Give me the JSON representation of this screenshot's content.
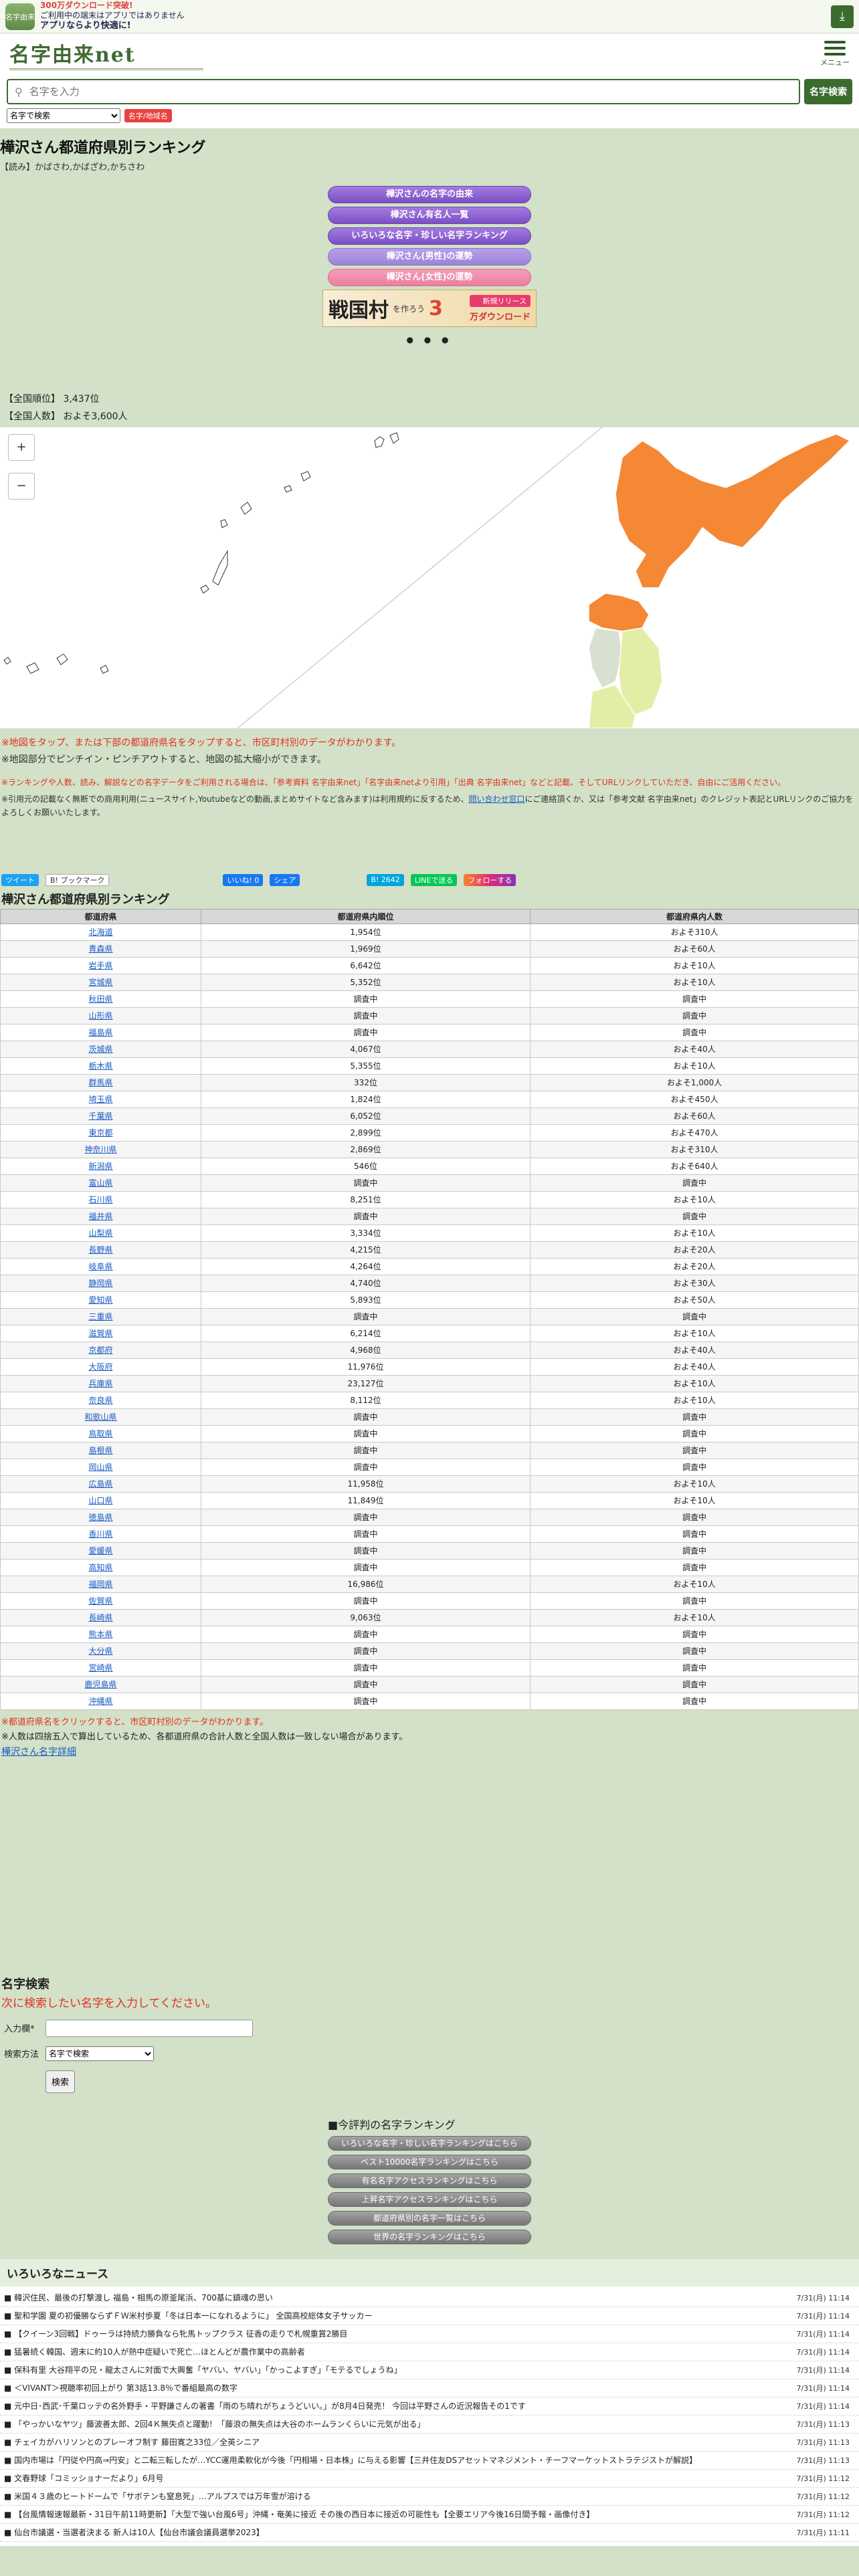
{
  "appbar": {
    "icon_label": "名字由来",
    "line1": "300万ダウンロード突破!",
    "line2": "ご利用中の端末はアプリではありません",
    "line3": "アプリならより快適に!",
    "download_icon": "download-icon"
  },
  "header": {
    "logo": "名字由来net",
    "menu_label": "メニュー"
  },
  "search": {
    "placeholder": "名字を入力",
    "button": "名字検索",
    "mode": "名字で検索",
    "badge": "名字/地域名"
  },
  "page": {
    "title": "樺沢さん都道府県別ランキング",
    "reading": "【読み】かばさわ,かばざわ,かちさわ",
    "buttons": [
      "樺沢さんの名字の由来",
      "樺沢さん有名人一覧",
      "いろいろな名字・珍しい名字ランキング",
      "樺沢さん(男性)の運勢",
      "樺沢さん(女性)の運勢"
    ],
    "banner": {
      "big": "戦国村",
      "mid": "を作ろう",
      "num": "3",
      "new": "新規リリース",
      "dl": "万ダウンロード"
    },
    "dots": "● ● ●",
    "national_rank": "【全国順位】 3,437位",
    "national_count": "【全国人数】 およそ3,600人"
  },
  "map": {
    "zoom_in": "+",
    "zoom_out": "−"
  },
  "notes": {
    "tap_note": "※地図をタップ、または下部の都道府県名をタップすると、市区町村別のデータがわかります。",
    "pinch_note": "※地図部分でピンチイン・ピンチアウトすると、地図の拡大縮小ができます。",
    "credit_note": "※ランキングや人数、読み、解説などの名字データをご利用される場合は、「参考資料 名字由来net」「名字由来netより引用」「出典 名字由来net」などと記載、そしてURLリンクしていただき、自由にご活用ください。",
    "contact_pre": "※引用元の記載なく無断での商用利用(ニュースサイト,Youtubeなどの動画,まとめサイトなど含みます)は利用規約に反するため、",
    "contact_link": "問い合わせ窓口",
    "contact_post": "にご連絡頂くか、又は「参考文献 名字由来net」のクレジット表記とURLリンクのご協力をよろしくお願いいたします。"
  },
  "share": {
    "twitter": "ツイート",
    "hatena": "B! ブックマーク",
    "fb_like": "いいね! 0",
    "fb_share": "シェア",
    "bookmark": "B! 2642",
    "line": "LINEで送る",
    "instagram": "フォローする"
  },
  "table": {
    "title": "樺沢さん都道府県別ランキング",
    "headers": [
      "都道府県",
      "都道府県内順位",
      "都道府県内人数"
    ],
    "rows": [
      [
        "北海道",
        "1,954位",
        "およそ310人"
      ],
      [
        "青森県",
        "1,969位",
        "およそ60人"
      ],
      [
        "岩手県",
        "6,642位",
        "およそ10人"
      ],
      [
        "宮城県",
        "5,352位",
        "およそ10人"
      ],
      [
        "秋田県",
        "調査中",
        "調査中"
      ],
      [
        "山形県",
        "調査中",
        "調査中"
      ],
      [
        "福島県",
        "調査中",
        "調査中"
      ],
      [
        "茨城県",
        "4,067位",
        "およそ40人"
      ],
      [
        "栃木県",
        "5,355位",
        "およそ10人"
      ],
      [
        "群馬県",
        "332位",
        "およそ1,000人"
      ],
      [
        "埼玉県",
        "1,824位",
        "およそ450人"
      ],
      [
        "千葉県",
        "6,052位",
        "およそ60人"
      ],
      [
        "東京都",
        "2,899位",
        "およそ470人"
      ],
      [
        "神奈川県",
        "2,869位",
        "およそ310人"
      ],
      [
        "新潟県",
        "546位",
        "およそ640人"
      ],
      [
        "富山県",
        "調査中",
        "調査中"
      ],
      [
        "石川県",
        "8,251位",
        "およそ10人"
      ],
      [
        "福井県",
        "調査中",
        "調査中"
      ],
      [
        "山梨県",
        "3,334位",
        "およそ10人"
      ],
      [
        "長野県",
        "4,215位",
        "およそ20人"
      ],
      [
        "岐阜県",
        "4,264位",
        "およそ20人"
      ],
      [
        "静岡県",
        "4,740位",
        "およそ30人"
      ],
      [
        "愛知県",
        "5,893位",
        "およそ50人"
      ],
      [
        "三重県",
        "調査中",
        "調査中"
      ],
      [
        "滋賀県",
        "6,214位",
        "およそ10人"
      ],
      [
        "京都府",
        "4,968位",
        "およそ40人"
      ],
      [
        "大阪府",
        "11,976位",
        "およそ40人"
      ],
      [
        "兵庫県",
        "23,127位",
        "およそ10人"
      ],
      [
        "奈良県",
        "8,112位",
        "およそ10人"
      ],
      [
        "和歌山県",
        "調査中",
        "調査中"
      ],
      [
        "鳥取県",
        "調査中",
        "調査中"
      ],
      [
        "島根県",
        "調査中",
        "調査中"
      ],
      [
        "岡山県",
        "調査中",
        "調査中"
      ],
      [
        "広島県",
        "11,958位",
        "およそ10人"
      ],
      [
        "山口県",
        "11,849位",
        "およそ10人"
      ],
      [
        "徳島県",
        "調査中",
        "調査中"
      ],
      [
        "香川県",
        "調査中",
        "調査中"
      ],
      [
        "愛媛県",
        "調査中",
        "調査中"
      ],
      [
        "高知県",
        "調査中",
        "調査中"
      ],
      [
        "福岡県",
        "16,986位",
        "およそ10人"
      ],
      [
        "佐賀県",
        "調査中",
        "調査中"
      ],
      [
        "長崎県",
        "9,063位",
        "およそ10人"
      ],
      [
        "熊本県",
        "調査中",
        "調査中"
      ],
      [
        "大分県",
        "調査中",
        "調査中"
      ],
      [
        "宮崎県",
        "調査中",
        "調査中"
      ],
      [
        "鹿児島県",
        "調査中",
        "調査中"
      ],
      [
        "沖縄県",
        "調査中",
        "調査中"
      ]
    ]
  },
  "after_table": {
    "red_note": "※都道府県名をクリックすると、市区町村別のデータがわかります。",
    "round_note": "※人数は四捨五入で算出しているため、各都道府県の合計人数と全国人数は一致しない場合があります。",
    "detail_link": "樺沢さん名字詳細"
  },
  "name_search": {
    "title": "名字検索",
    "subtitle": "次に検索したい名字を入力してください。",
    "input_label": "入力欄*",
    "method_label": "検索方法",
    "method_value": "名字で検索",
    "submit": "検索"
  },
  "rank_menu": {
    "title": "■今評判の名字ランキング",
    "items": [
      "いろいろな名字・珍しい名字ランキングはこちら",
      "ベスト10000名字ランキングはこちら",
      "有名名字アクセスランキングはこちら",
      "上昇名字アクセスランキングはこちら",
      "都道府県別の名字一覧はこちら",
      "世界の名字ランキングはこちら"
    ]
  },
  "news": {
    "title": "いろいろなニュース",
    "items": [
      [
        "■ 韓沢住民、最後の打撃渡し 福島・相馬の原釜尾浜、700基に鎮魂の思い",
        "7/31(月) 11:14"
      ],
      [
        "■ 聖和学園 夏の初優勝ならずＦＷ米村歩夏「冬は日本一になれるように」 全国高校総体女子サッカー",
        "7/31(月) 11:14"
      ],
      [
        "■ 【クイーン3回戦】ドゥーラは持続力勝負なら牝馬トップクラス 征香の走りで札幌重賞2勝目",
        "7/31(月) 11:14"
      ],
      [
        "■ 猛暑続く韓国、週末に約10人が熱中症疑いで死亡…ほとんどが農作業中の高齢者",
        "7/31(月) 11:14"
      ],
      [
        "■ 保科有里 大谷翔平の兄・龍太さんに対面で大興奮「ヤバい、ヤバい」「かっこよすぎ」「モテるでしょうね」",
        "7/31(月) 11:14"
      ],
      [
        "■ ＜VIVANT＞視聴率初回上がり 第3話13.8％で番組最高の数字",
        "7/31(月) 11:14"
      ],
      [
        "■ 元中日･西武･千葉ロッテの名外野手・平野謙さんの著書「雨のち晴れがちょうどいい。」が8月4日発売！ 今回は平野さんの近況報告その1です",
        "7/31(月) 11:14"
      ],
      [
        "■ 「やっかいなヤツ」藤波善太郎、2回4Ｋ無失点と躍動！「藤浪の無失点は大谷のホームランくらいに元気が出る」",
        "7/31(月) 11:13"
      ],
      [
        "■ チェイカがハリソンとのプレーオフ制す 藤田寛之33位／全英シニア",
        "7/31(月) 11:13"
      ],
      [
        "■ 国内市場は「円従や円高⇒円安」と二転三転したが…YCC運用柔軟化が今後「円相場・日本株」に与える影響【三井住友DSアセットマネジメント・チーフマーケットストラテジストが解説】",
        "7/31(月) 11:13"
      ],
      [
        "■ 文春野球「コミッショナーだより」6月号",
        "7/31(月) 11:12"
      ],
      [
        "■ 米国４３歳のヒートドームで「サボテンも窒息死」…アルプスでは万年雪が溶ける",
        "7/31(月) 11:12"
      ],
      [
        "■ 【台風情報速報最新・31日午前11時更新】「大型で強い台風6号」沖縄・奄美に接近 その後の西日本に接近の可能性も【全要エリア今後16日間予報・画像付き】",
        "7/31(月) 11:12"
      ],
      [
        "■ 仙台市議選・当選者決まる 新人は10人【仙台市議会議員選挙2023】",
        "7/31(月) 11:11"
      ]
    ]
  }
}
